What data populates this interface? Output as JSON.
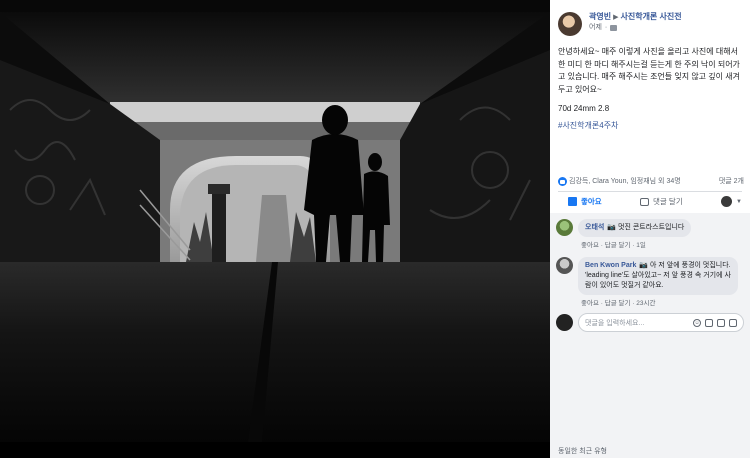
{
  "post": {
    "author": "곽영빈",
    "group": "사진학개론 사진전",
    "time": "어제",
    "text": "안녕하세요~ 매주 이렇게 사진을 올리고 사진에 대해서 한 미디 한 마디 해주시는걸 듣는게 한 주의 낙이 되어가고 있습니다. 매주 해주시는 조언들 잊지 않고 깊이 새겨두고 있어요~",
    "lens": "70d 24mm 2.8",
    "hashtag": "#사진학개론4주차"
  },
  "reactions": {
    "summary": "김강득, Clara Youn, 임정재님 외 34명",
    "comment_count": "댓글 2개"
  },
  "actions": {
    "like": "좋아요",
    "comment": "댓글 달기"
  },
  "comments": [
    {
      "name": "오태석",
      "text": "멋진 콘트라스트입니다",
      "like": "좋아요",
      "reply": "답글 달기",
      "time": "1일"
    },
    {
      "name": "Ben Kwon Park",
      "text": "아 저 앞에 풍경이 멋집니다. 'leading line'도 살아있고~ 저 앞 풍경 속 거기에 사람이 있어도 멋질거 같아요.",
      "like": "좋아요",
      "reply": "답글 달기",
      "time": "23시간"
    }
  ],
  "input": {
    "placeholder": "댓글을 입력하세요..."
  },
  "footer": "동일한 최근 유형"
}
